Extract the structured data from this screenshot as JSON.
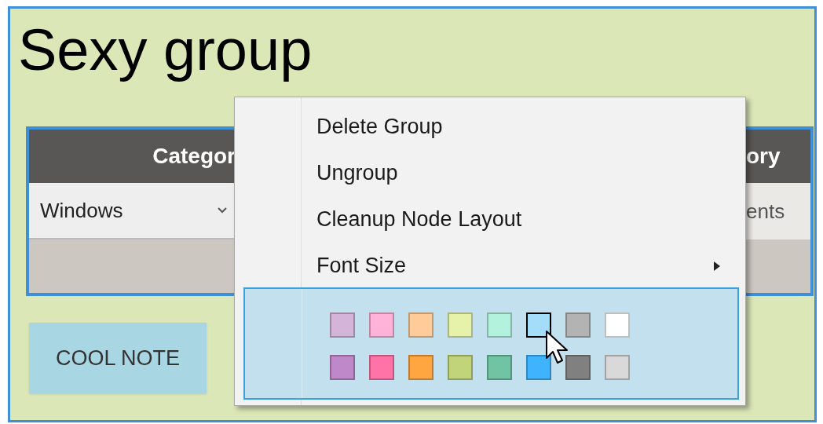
{
  "group": {
    "title": "Sexy group"
  },
  "node": {
    "header_left": "Categor",
    "header_right": "ory",
    "dropdown": {
      "value": "Windows"
    },
    "row_right": "ents"
  },
  "note": {
    "text": "COOL NOTE"
  },
  "context_menu": {
    "items": [
      {
        "label": "Delete Group",
        "kind": "item"
      },
      {
        "label": "Ungroup",
        "kind": "item"
      },
      {
        "label": "Cleanup Node Layout",
        "kind": "item"
      },
      {
        "label": "Font Size",
        "kind": "submenu"
      }
    ],
    "swatches": [
      {
        "color": "#d4b5d9",
        "selected": false
      },
      {
        "color": "#ffb3d9",
        "selected": false
      },
      {
        "color": "#ffcc99",
        "selected": false
      },
      {
        "color": "#e6f2aa",
        "selected": false
      },
      {
        "color": "#b3f2dc",
        "selected": false
      },
      {
        "color": "#a3ddfa",
        "selected": true
      },
      {
        "color": "#b3b3b3",
        "selected": false
      },
      {
        "color": "#ffffff",
        "selected": false
      },
      {
        "color": "#bf88c9",
        "selected": false
      },
      {
        "color": "#ff73a6",
        "selected": false
      },
      {
        "color": "#ffa640",
        "selected": false
      },
      {
        "color": "#c2d47a",
        "selected": false
      },
      {
        "color": "#70c4a3",
        "selected": false
      },
      {
        "color": "#40b3ff",
        "selected": false
      },
      {
        "color": "#808080",
        "selected": false
      },
      {
        "color": "#d9d9d9",
        "selected": false
      }
    ]
  }
}
